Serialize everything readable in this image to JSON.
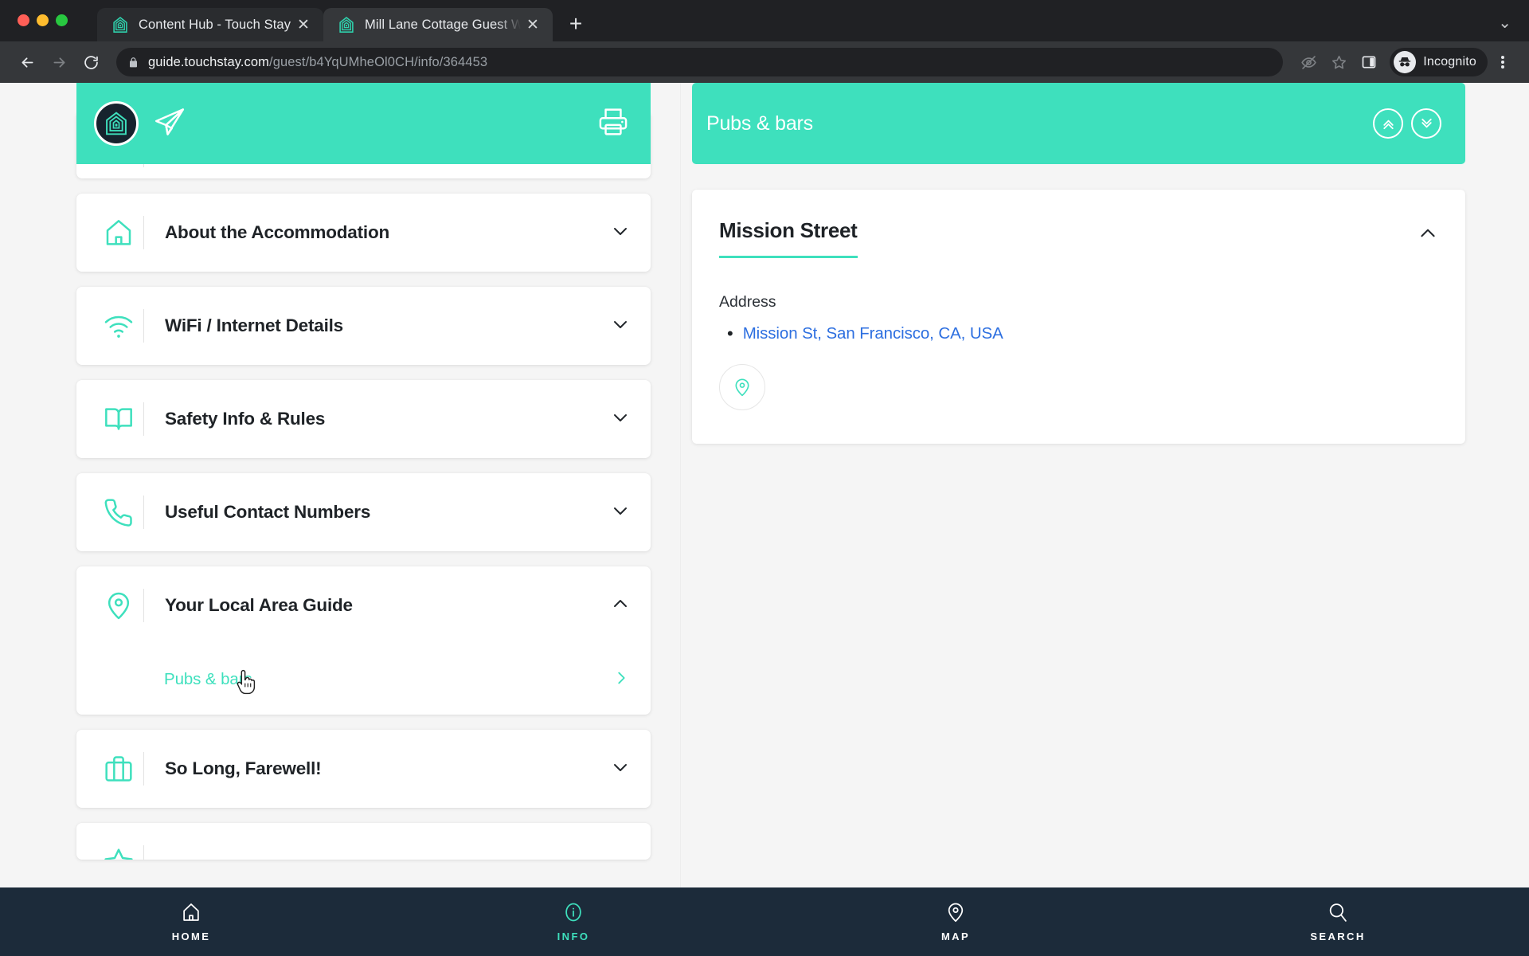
{
  "browser": {
    "tabs": [
      {
        "title": "Content Hub - Touch Stay",
        "favicon": "touchstay-house-icon",
        "active": false,
        "close_label": "✕"
      },
      {
        "title": "Mill Lane Cottage Guest Welco",
        "favicon": "touchstay-house-icon",
        "active": true,
        "close_label": "✕"
      }
    ],
    "new_tab_label": "+",
    "tablist_menu_icon": "chevron-down-icon",
    "url": {
      "host": "guide.touchstay.com",
      "path": "/guest/b4YqUMheOl0CH/info/364453"
    },
    "lock_icon": "lock-icon",
    "nav": {
      "back": "back-arrow-icon",
      "forward": "forward-arrow-icon",
      "reload": "reload-icon"
    },
    "toolbar_right": {
      "tracking_icon": "eye-slash-icon",
      "bookmark_icon": "star-icon",
      "side_panel_icon": "side-panel-icon",
      "incognito_label": "Incognito",
      "incognito_icon": "incognito-hat-icon",
      "menu_icon": "kebab-menu-icon"
    }
  },
  "colors": {
    "brand_teal": "#3ee0bd",
    "nav_dark": "#1c2b3a",
    "link_blue": "#2d6fe0",
    "text_dark": "#1f2327"
  },
  "left_panel": {
    "header": {
      "logo_icon": "touchstay-house-logo",
      "share_icon": "paper-plane-icon",
      "print_icon": "printer-icon"
    },
    "sections": [
      {
        "label": "",
        "icon": "partial-icon",
        "chevron": "chevron-down-icon",
        "clipped": "top"
      },
      {
        "label": "About the Accommodation",
        "icon": "house-icon",
        "chevron": "chevron-down-icon",
        "expanded": false
      },
      {
        "label": "WiFi / Internet Details",
        "icon": "wifi-icon",
        "chevron": "chevron-down-icon",
        "expanded": false
      },
      {
        "label": "Safety Info & Rules",
        "icon": "open-book-icon",
        "chevron": "chevron-down-icon",
        "expanded": false
      },
      {
        "label": "Useful Contact Numbers",
        "icon": "phone-icon",
        "chevron": "chevron-down-icon",
        "expanded": false
      },
      {
        "label": "Your Local Area Guide",
        "icon": "map-pin-icon",
        "chevron": "chevron-up-icon",
        "expanded": true
      },
      {
        "label": "So Long, Farewell!",
        "icon": "suitcase-icon",
        "chevron": "chevron-down-icon",
        "expanded": false
      },
      {
        "label": "",
        "icon": "partial-icon",
        "chevron": "chevron-down-icon",
        "clipped": "bottom"
      }
    ],
    "sub_items": [
      {
        "label": "Pubs & bars",
        "arrow": "chevron-right-icon",
        "active": true
      }
    ]
  },
  "right_panel": {
    "header": {
      "title": "Pubs & bars",
      "collapse_all_icon": "double-chevron-up-icon",
      "expand_all_icon": "double-chevron-down-icon"
    },
    "entry": {
      "title": "Mission Street",
      "collapse_icon": "chevron-up-icon",
      "address_label": "Address",
      "address_value": "Mission St, San Francisco, CA, USA",
      "bullet": "•",
      "map_pin_icon": "map-pin-icon"
    }
  },
  "bottom_nav": [
    {
      "label": "HOME",
      "icon": "home-icon",
      "active": false
    },
    {
      "label": "INFO",
      "icon": "info-circle-icon",
      "active": true
    },
    {
      "label": "MAP",
      "icon": "map-pin-icon",
      "active": false
    },
    {
      "label": "SEARCH",
      "icon": "search-icon",
      "active": false
    }
  ]
}
